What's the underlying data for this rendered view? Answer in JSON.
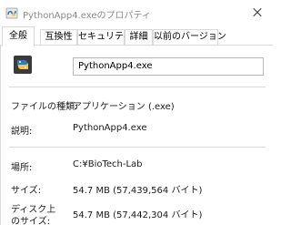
{
  "window": {
    "title": "PythonApp4.exeのプロパティ",
    "close_icon": "close-icon"
  },
  "tabs": [
    {
      "label": "全般",
      "active": true
    },
    {
      "label": "互換性",
      "active": false
    },
    {
      "label": "セキュリティ",
      "active": false
    },
    {
      "label": "詳細",
      "active": false
    },
    {
      "label": "以前のバージョン",
      "active": false
    }
  ],
  "general": {
    "file_name": "PythonApp4.exe",
    "file_type_label": "ファイルの種類:",
    "file_type_value": "アプリケーション (.exe)",
    "description_label": "説明:",
    "description_value": "PythonApp4.exe",
    "location_label": "場所:",
    "location_value": "C:¥BioTech-Lab",
    "size_label": "サイズ:",
    "size_value": "54.7 MB (57,439,564 バイト)",
    "disk_size_label_1": "ディスク上",
    "disk_size_label_2": "のサイズ:",
    "disk_size_value": "54.7 MB (57,442,304 バイト)"
  }
}
